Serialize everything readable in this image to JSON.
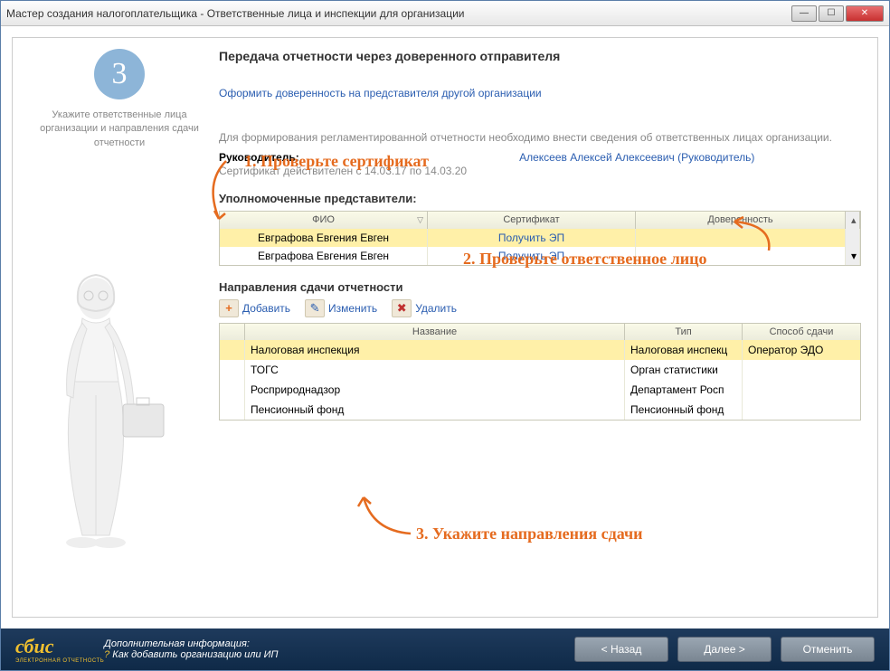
{
  "window": {
    "title": "Мастер создания налогоплательщика - Ответственные лица и инспекции для организации"
  },
  "sidebar": {
    "step_number": "3",
    "step_description": "Укажите ответственные лица организации и направления сдачи отчетности"
  },
  "page": {
    "title": "Передача отчетности через доверенного отправителя",
    "proxy_link": "Оформить доверенность на представителя другой организации",
    "info_text": "Для формирования регламентированной отчетности необходимо внести сведения об ответственных лицах организации.",
    "director_label": "Руководитель:",
    "cert_validity": "Сертификат действителен с 14.03.17 по 14.03.20",
    "director_value": "Алексеев Алексей Алексеевич (Руководитель)"
  },
  "annotations": {
    "a1": "1. Проверьте сертификат",
    "a2": "2. Проверьте ответственное лицо",
    "a3": "3. Укажите направления сдачи"
  },
  "reps": {
    "title": "Уполномоченные представители:",
    "columns": {
      "fio": "ФИО",
      "cert": "Сертификат",
      "proxy": "Доверенность"
    },
    "rows": [
      {
        "fio": "Евграфова Евгения Евген",
        "cert": "Получить ЭП",
        "proxy": ""
      },
      {
        "fio": "Евграфова Евгения Евген",
        "cert": "Получить ЭП",
        "proxy": ""
      }
    ]
  },
  "directions": {
    "title": "Направления сдачи отчетности",
    "toolbar": {
      "add": "Добавить",
      "edit": "Изменить",
      "del": "Удалить"
    },
    "columns": {
      "name": "Название",
      "type": "Тип",
      "method": "Способ сдачи"
    },
    "rows": [
      {
        "name": "Налоговая инспекция",
        "type": "Налоговая инспекц",
        "method": "Оператор ЭДО"
      },
      {
        "name": "ТОГС",
        "type": "Орган статистики",
        "method": ""
      },
      {
        "name": "Росприроднадзор",
        "type": "Департамент Росп",
        "method": ""
      },
      {
        "name": "Пенсионный фонд",
        "type": "Пенсионный фонд",
        "method": ""
      }
    ]
  },
  "footer": {
    "logo": "сбис",
    "logo_sub": "ЭЛЕКТРОННАЯ ОТЧЕТНОСТЬ",
    "info_title": "Дополнительная информация:",
    "info_question": "Как добавить организацию или ИП",
    "back": "< Назад",
    "next": "Далее >",
    "cancel": "Отменить"
  }
}
